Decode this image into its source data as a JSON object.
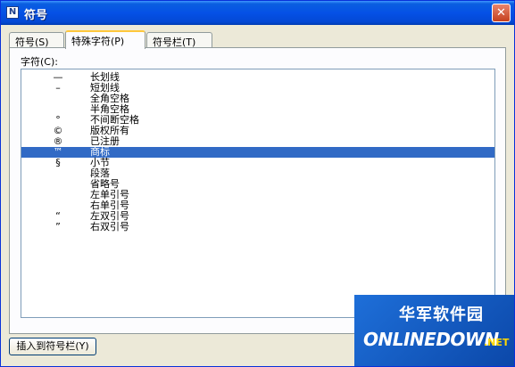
{
  "window": {
    "title": "符号",
    "app_icon": "N",
    "close": "✕"
  },
  "tabs": [
    {
      "label": "符号(S)",
      "active": false
    },
    {
      "label": "特殊字符(P)",
      "active": true
    },
    {
      "label": "符号栏(T)",
      "active": false
    }
  ],
  "list": {
    "label": "字符(C):",
    "items": [
      {
        "symbol": "—",
        "name": "长划线"
      },
      {
        "symbol": "–",
        "name": "短划线"
      },
      {
        "symbol": "",
        "name": "全角空格"
      },
      {
        "symbol": "",
        "name": "半角空格"
      },
      {
        "symbol": "°",
        "name": "不间断空格"
      },
      {
        "symbol": "©",
        "name": "版权所有"
      },
      {
        "symbol": "®",
        "name": "已注册"
      },
      {
        "symbol": "™",
        "name": "商标",
        "selected": true
      },
      {
        "symbol": "§",
        "name": "小节"
      },
      {
        "symbol": "",
        "name": "段落"
      },
      {
        "symbol": "",
        "name": "省略号"
      },
      {
        "symbol": "",
        "name": "左单引号"
      },
      {
        "symbol": "",
        "name": "右单引号"
      },
      {
        "symbol": "“",
        "name": "左双引号"
      },
      {
        "symbol": "”",
        "name": "右双引号"
      }
    ]
  },
  "buttons": {
    "insert": "插入到符号栏(Y)"
  },
  "watermark": {
    "cn": "华军软件园",
    "en": "ONLINEDOWN",
    "suffix": ".NET"
  }
}
